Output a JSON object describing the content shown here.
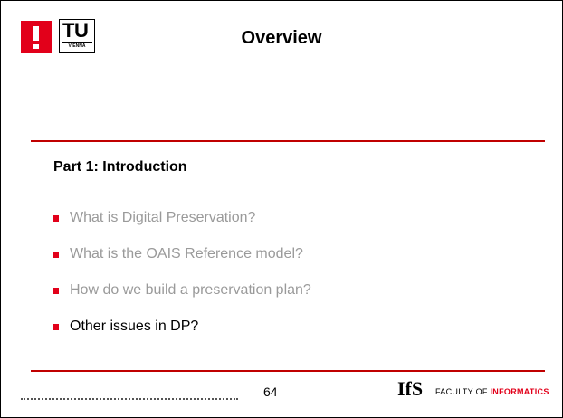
{
  "slide": {
    "title": "Overview",
    "section_heading": "Part 1: Introduction",
    "bullets": [
      {
        "text": "What is Digital Preservation?",
        "state": "dimmed"
      },
      {
        "text": "What is the OAIS Reference model?",
        "state": "dimmed"
      },
      {
        "text": "How do we build a preservation plan?",
        "state": "dimmed"
      },
      {
        "text": "Other issues in DP?",
        "state": "active"
      }
    ]
  },
  "logos": {
    "tu_text": "TU",
    "tu_subtext": "VIENNA",
    "exclamation_color": "#e2001a",
    "ifs_text": "IfS"
  },
  "footer": {
    "page_number": "64",
    "faculty_prefix": "FACULTY OF",
    "faculty_highlight": "INFORMATICS"
  },
  "colors": {
    "accent": "#c00000",
    "bullet": "#e2001a",
    "dimmed_text": "#9a9a9a",
    "active_text": "#000000"
  }
}
